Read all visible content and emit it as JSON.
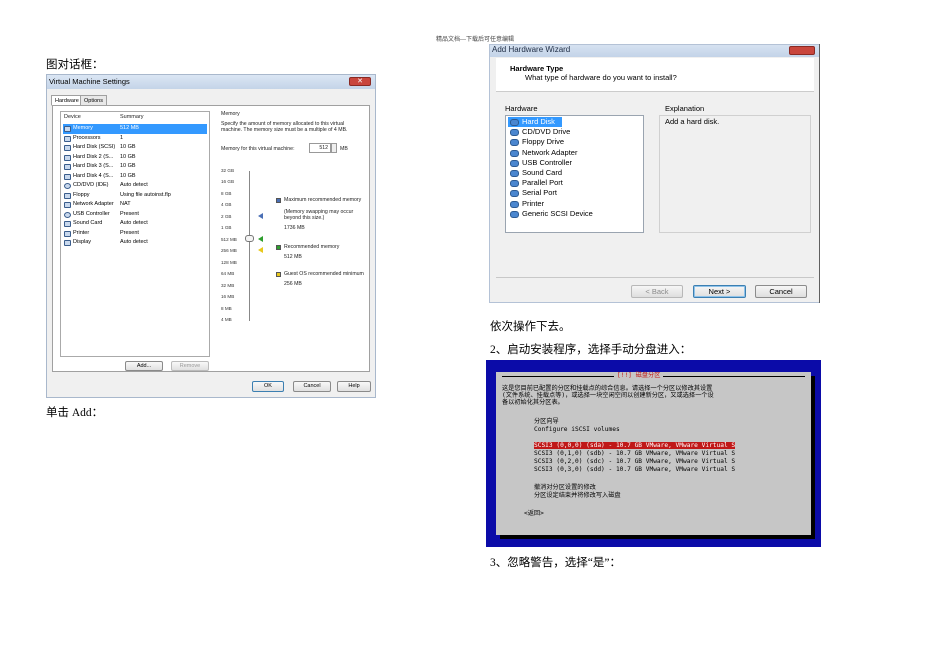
{
  "document": {
    "header": "精品文档---下载后可任意编辑",
    "left_col": {
      "caption_top": "图对话框：",
      "caption_bottom": "单击 Add："
    },
    "right_col": {
      "step_next": "依次操作下去。",
      "step2": "2、启动安装程序，选择手动分盘进入：",
      "step3": "3、忽略警告，选择“是”："
    }
  },
  "vm_settings": {
    "title": "Virtual Machine Settings",
    "close_glyph": "✕",
    "tabs": [
      "Hardware",
      "Options"
    ],
    "device_header": "Device",
    "summary_header": "Summary",
    "devices": [
      {
        "name": "Memory",
        "summary": "512 MB"
      },
      {
        "name": "Processors",
        "summary": "1"
      },
      {
        "name": "Hard Disk (SCSI)",
        "summary": "10 GB"
      },
      {
        "name": "Hard Disk 2 (S...",
        "summary": "10 GB"
      },
      {
        "name": "Hard Disk 3 (S...",
        "summary": "10 GB"
      },
      {
        "name": "Hard Disk 4 (S...",
        "summary": "10 GB"
      },
      {
        "name": "CD/DVD (IDE)",
        "summary": "Auto detect"
      },
      {
        "name": "Floppy",
        "summary": "Using file autoinst.flp"
      },
      {
        "name": "Network Adapter",
        "summary": "NAT"
      },
      {
        "name": "USB Controller",
        "summary": "Present"
      },
      {
        "name": "Sound Card",
        "summary": "Auto detect"
      },
      {
        "name": "Printer",
        "summary": "Present"
      },
      {
        "name": "Display",
        "summary": "Auto detect"
      }
    ],
    "add_button": "Add...",
    "remove_button": "Remove",
    "memory": {
      "section_title": "Memory",
      "description": "Specify the amount of memory allocated to this virtual machine. The memory size must be a multiple of 4 MB.",
      "field_label": "Memory for this virtual machine:",
      "value": "512",
      "unit": "MB",
      "ticks": [
        "32 GB",
        "16 GB",
        "8 GB",
        "4 GB",
        "2 GB",
        "1 GB",
        "512 MB",
        "256 MB",
        "128 MB",
        "64 MB",
        "32 MB",
        "16 MB",
        "8 MB",
        "4 MB"
      ],
      "legend": [
        {
          "label": "Maximum recommended memory",
          "note": "(Memory swapping may occur beyond this size.)",
          "value": "1736 MB",
          "color": "#4a6fb5"
        },
        {
          "label": "Recommended memory",
          "value": "512 MB",
          "color": "#2e9e2e"
        },
        {
          "label": "Guest OS recommended minimum",
          "value": "256 MB",
          "color": "#e8c81c"
        }
      ]
    },
    "ok_button": "OK",
    "cancel_button": "Cancel",
    "help_button": "Help"
  },
  "wizard": {
    "title": "Add Hardware Wizard",
    "heading": "Hardware Type",
    "subheading": "What type of hardware do you want to install?",
    "hardware_label": "Hardware",
    "explanation_label": "Explanation",
    "explanation_text": "Add a hard disk.",
    "items": [
      "Hard Disk",
      "CD/DVD Drive",
      "Floppy Drive",
      "Network Adapter",
      "USB Controller",
      "Sound Card",
      "Parallel Port",
      "Serial Port",
      "Printer",
      "Generic SCSI Device"
    ],
    "back_button": "< Back",
    "next_button": "Next >",
    "cancel_button": "Cancel"
  },
  "installer": {
    "title": "[!!] 磁盘分区",
    "intro": [
      "这是您目前已配置的分区和挂载点的综合信息。请选择一个分区以修改其设置",
      "(文件系统、挂载点等)，或选择一块空闲空间以创建新分区，又或选择一个设",
      "备以初始化其分区表。"
    ],
    "guide_title": "分区向导",
    "iscsi": "Configure iSCSI volumes",
    "disks": [
      "SCSI3 (0,0,0) (sda) - 10.7 GB VMware, VMware Virtual S",
      "SCSI3 (0,1,0) (sdb) - 10.7 GB VMware, VMware Virtual S",
      "SCSI3 (0,2,0) (sdc) - 10.7 GB VMware, VMware Virtual S",
      "SCSI3 (0,3,0) (sdd) - 10.7 GB VMware, VMware Virtual S"
    ],
    "undo": "撤消对分区设置的修改",
    "finish": "分区设定结束并将修改写入磁盘",
    "back": "<返回>"
  }
}
